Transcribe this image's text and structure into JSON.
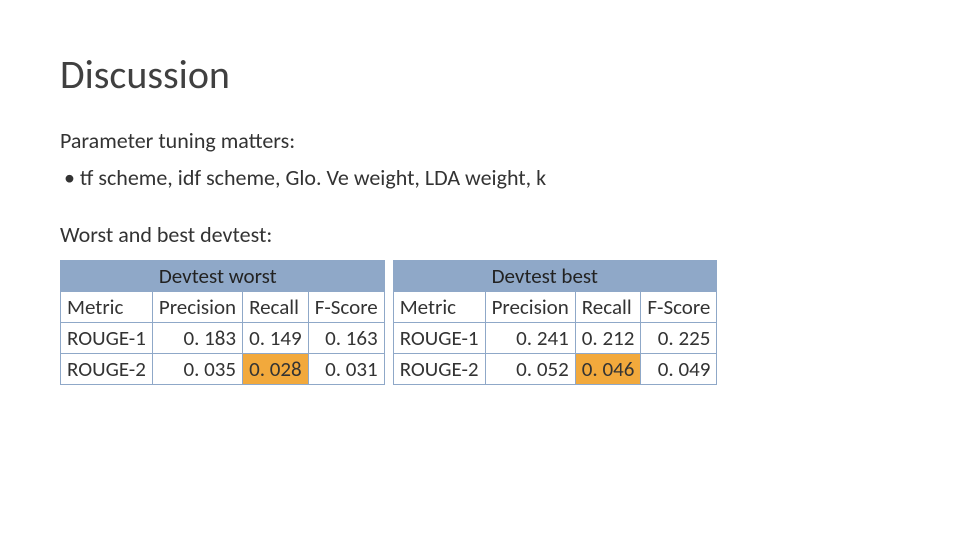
{
  "title": "Discussion",
  "para1": "Parameter tuning matters:",
  "bullet": "• tf scheme, idf scheme, Glo. Ve weight, LDA weight, k",
  "para2": "Worst and best devtest:",
  "tables": {
    "left": {
      "title": "Devtest worst",
      "headers": {
        "metric": "Metric",
        "precision": "Precision",
        "recall": "Recall",
        "fscore": "F-Score"
      },
      "rows": [
        {
          "metric": "ROUGE-1",
          "precision": "0. 183",
          "recall": "0. 149",
          "fscore": "0. 163"
        },
        {
          "metric": "ROUGE-2",
          "precision": "0. 035",
          "recall": "0. 028",
          "fscore": "0. 031"
        }
      ]
    },
    "right": {
      "title": "Devtest best",
      "headers": {
        "metric": "Metric",
        "precision": "Precision",
        "recall": "Recall",
        "fscore": "F-Score"
      },
      "rows": [
        {
          "metric": "ROUGE-1",
          "precision": "0. 241",
          "recall": "0. 212",
          "fscore": "0. 225"
        },
        {
          "metric": "ROUGE-2",
          "precision": "0. 052",
          "recall": "0. 046",
          "fscore": "0. 049"
        }
      ]
    }
  },
  "chart_data": [
    {
      "type": "table",
      "title": "Devtest worst",
      "columns": [
        "Metric",
        "Precision",
        "Recall",
        "F-Score"
      ],
      "rows": [
        [
          "ROUGE-1",
          0.183,
          0.149,
          0.163
        ],
        [
          "ROUGE-2",
          0.035,
          0.028,
          0.031
        ]
      ],
      "highlight": {
        "row": 1,
        "col": 2
      }
    },
    {
      "type": "table",
      "title": "Devtest best",
      "columns": [
        "Metric",
        "Precision",
        "Recall",
        "F-Score"
      ],
      "rows": [
        [
          "ROUGE-1",
          0.241,
          0.212,
          0.225
        ],
        [
          "ROUGE-2",
          0.052,
          0.046,
          0.049
        ]
      ],
      "highlight": {
        "row": 1,
        "col": 2
      }
    }
  ]
}
